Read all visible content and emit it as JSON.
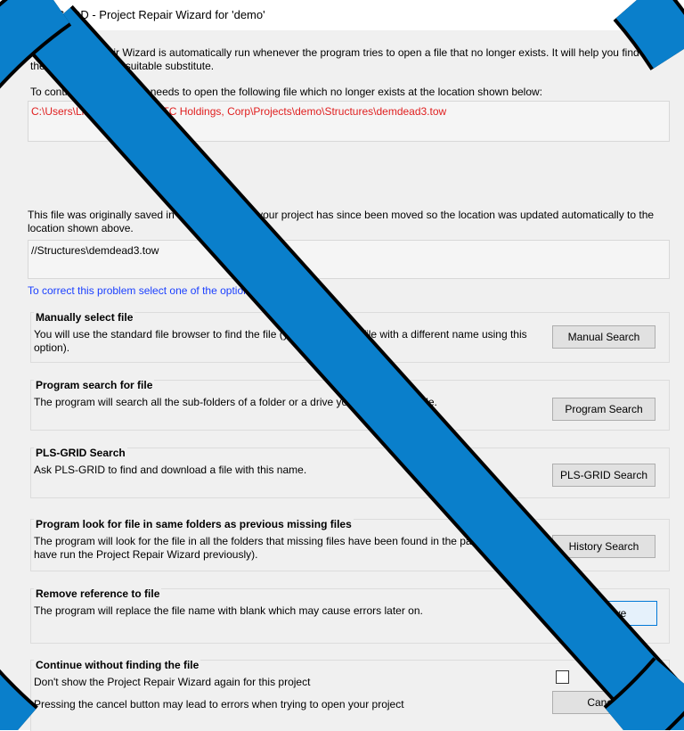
{
  "title": "PLS-CADD - Project Repair Wizard for 'demo'",
  "title_visible": "Project Repair Wizard for 'demo'",
  "intro": "The Project Repair Wizard is automatically run whenever the program tries to open a file that no longer exists.  It will help you find the missing file or a suitable substitute.",
  "needs_file_text": "To continue this program needs to open the following file which no longer exists at the location shown below:",
  "missing_path": "C:\\Users\\Linda\\OneDrive - ITC Holdings, Corp\\Projects\\demo\\Structures\\demdead3.tow",
  "originally_text": "This file was originally saved in this location, but your project has since been moved so the location was updated automatically to the location shown above.",
  "original_path": "//Structures\\demdead3.tow",
  "correct_text": "To correct this problem select one of the options below.",
  "options": [
    {
      "title": "Manually select file",
      "text": "You will use the standard file browser to find the file (you can select a file with a different name using this option).",
      "button": "Manual Search"
    },
    {
      "title": "Program search for file",
      "text": "The program will search all the sub-folders of a folder or a drive you select for the file.",
      "button": "Program Search"
    },
    {
      "title": "PLS-GRID Search",
      "text": "Ask PLS-GRID to find and download a file with this name.",
      "button": "PLS-GRID Search"
    },
    {
      "title": "Program look for file in same folders as previous missing files",
      "text": "The program will look for the file in all the folders that missing files have been found in the past (requires you to have run the Project Repair Wizard previously).",
      "button": "History Search"
    },
    {
      "title": "Remove reference to file",
      "text": "The program will replace the file name with blank which may cause errors later on.",
      "button": "Remove"
    },
    {
      "title": "Continue without finding the file",
      "checkbox_label": "Don't show the Project Repair Wizard again for this project",
      "cancel_text": "Pressing the cancel button may lead to errors when trying to open your project",
      "button": "Cancel"
    }
  ],
  "colors": {
    "overlay_stroke": "#0a7fcb",
    "overlay_border": "#000000",
    "error_text": "#e02020",
    "link_text": "#1a3fff"
  }
}
